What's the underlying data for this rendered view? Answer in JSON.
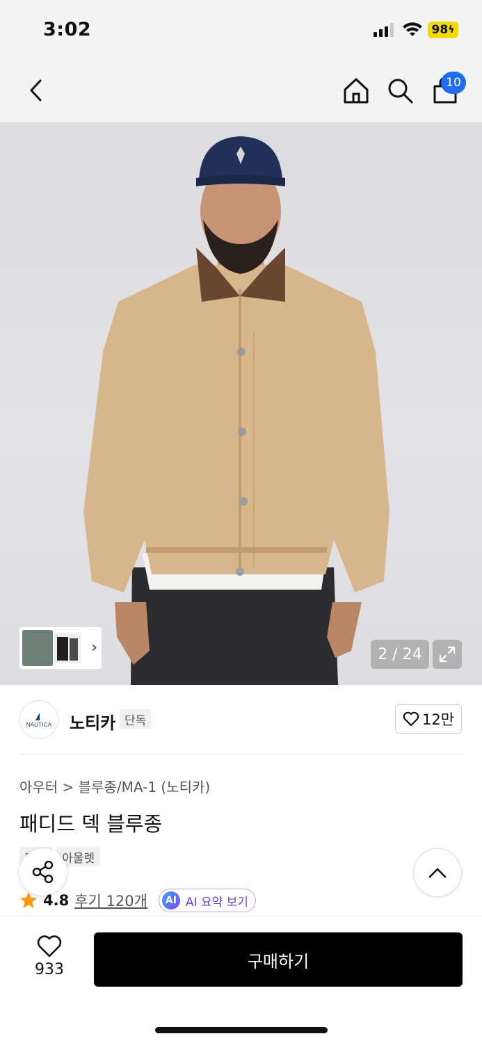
{
  "status_bar": {
    "time": "3:02",
    "battery": "98"
  },
  "nav": {
    "cart_count": "10"
  },
  "gallery": {
    "counter": "2 / 24"
  },
  "brand": {
    "logo_text": "NAUTICA",
    "name": "노티카",
    "tag": "단독",
    "like_count": "12만"
  },
  "product": {
    "breadcrumb": "아우터 > 블루종/MA-1 (노티카)",
    "title": "패디드 덱 블루종",
    "tags": [
      "단독",
      "아울렛"
    ],
    "rating": "4.8",
    "review_link": "후기 120개",
    "ai_badge": "AI",
    "ai_summary": "AI 요약 보기"
  },
  "bottom_bar": {
    "wish_count": "933",
    "buy_label": "구매하기"
  },
  "colors": {
    "cart_badge": "#1e6df0",
    "battery": "#f5d90a",
    "buy_button": "#000000",
    "ai_accent": "#6b3fd6",
    "star": "#f59a0c"
  }
}
